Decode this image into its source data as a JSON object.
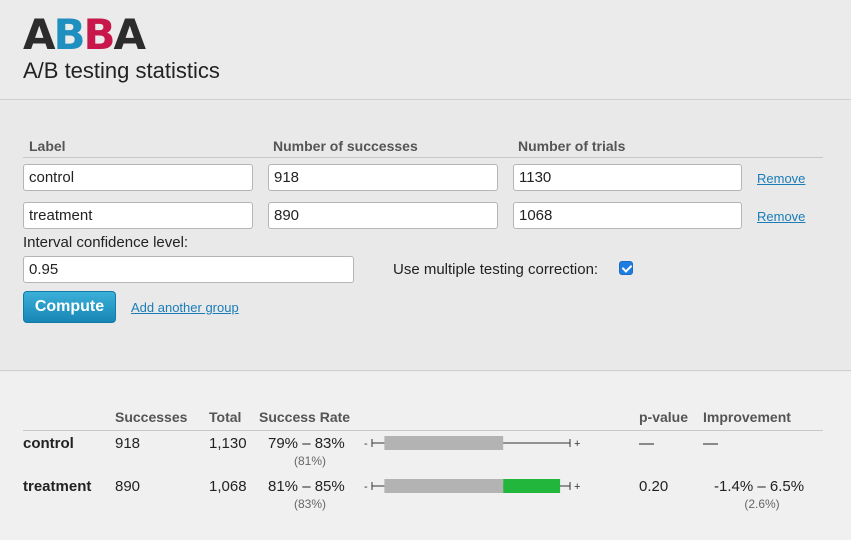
{
  "header": {
    "logo": [
      "A",
      "B",
      "B",
      "A"
    ],
    "subtitle": "A/B testing statistics"
  },
  "form": {
    "columns": {
      "label": "Label",
      "successes": "Number of successes",
      "trials": "Number of trials"
    },
    "groups": [
      {
        "label": "control",
        "successes": "918",
        "trials": "1130",
        "remove": "Remove"
      },
      {
        "label": "treatment",
        "successes": "890",
        "trials": "1068",
        "remove": "Remove"
      }
    ],
    "confidence_label": "Interval confidence level:",
    "confidence_value": "0.95",
    "multiple_testing_label": "Use multiple testing correction:",
    "multiple_testing_checked": true,
    "compute_label": "Compute",
    "add_group_label": "Add another group"
  },
  "results": {
    "headers": {
      "successes": "Successes",
      "total": "Total",
      "rate": "Success Rate",
      "pvalue": "p-value",
      "improvement": "Improvement"
    },
    "rows": [
      {
        "label": "control",
        "successes": "918",
        "total": "1,130",
        "rate_range": "79% – 83%",
        "rate_point": "(81%)",
        "pvalue": "—",
        "improvement_range": "—",
        "improvement_point": "",
        "interval_low": 0.785,
        "interval_high": 0.833
      },
      {
        "label": "treatment",
        "successes": "890",
        "total": "1,068",
        "rate_range": "81% – 85%",
        "rate_point": "(83%)",
        "pvalue": "0.20",
        "improvement_range": "-1.4% – 6.5%",
        "improvement_point": "(2.6%)",
        "interval_low": 0.809,
        "interval_high": 0.856
      }
    ],
    "plot_range": [
      0.78,
      0.86
    ],
    "colors": {
      "base_interval": "#b3b3b3",
      "improvement_interval": "#22b63c"
    }
  }
}
